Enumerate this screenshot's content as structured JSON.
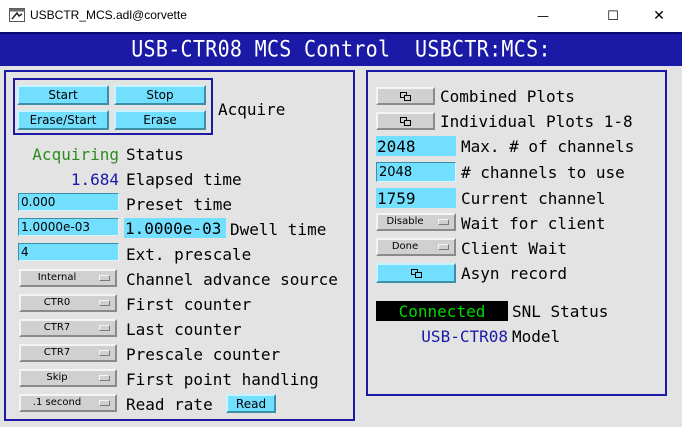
{
  "window": {
    "title": "USBCTR_MCS.adl@corvette",
    "minimize_glyph": "—",
    "maximize_glyph": "☐",
    "close_glyph": "✕"
  },
  "banner": {
    "title": "USB-CTR08 MCS Control  USBCTR:MCS:"
  },
  "acquire": {
    "start_label": "Start",
    "stop_label": "Stop",
    "erase_start_label": "Erase/Start",
    "erase_label": "Erase",
    "group_label": "Acquire"
  },
  "status": {
    "value": "Acquiring",
    "label": "Status",
    "value_color": "#2e8b20"
  },
  "elapsed": {
    "value": "1.684",
    "label": "Elapsed time",
    "value_color": "#1a1aa6"
  },
  "preset": {
    "value": "0.000",
    "label": "Preset time"
  },
  "dwell": {
    "input_value": "1.0000e-03",
    "readback": "1.0000e-03",
    "label": "Dwell time"
  },
  "prescale": {
    "value": "4",
    "label": "Ext. prescale"
  },
  "channel_advance": {
    "value": "Internal",
    "label": "Channel advance source"
  },
  "first_counter": {
    "value": "CTR0",
    "label": "First counter"
  },
  "last_counter": {
    "value": "CTR7",
    "label": "Last counter"
  },
  "prescale_counter": {
    "value": "CTR7",
    "label": "Prescale counter"
  },
  "first_point": {
    "value": "Skip",
    "label": "First point handling"
  },
  "read_rate": {
    "value": ".1 second",
    "label": "Read rate",
    "read_button": "Read"
  },
  "right": {
    "combined_plots": "Combined Plots",
    "individual_plots": "Individual Plots 1-8",
    "max_channels": {
      "value": "2048",
      "label": "Max. # of channels"
    },
    "channels_to_use": {
      "value": "2048",
      "label": "# channels to use"
    },
    "current_channel": {
      "value": "1759",
      "label": "Current channel"
    },
    "wait_for_client": {
      "value": "Disable",
      "label": "Wait for client"
    },
    "client_wait": {
      "value": "Done",
      "label": "Client Wait"
    },
    "asyn_record": {
      "label": "Asyn record"
    },
    "snl": {
      "value": "Connected",
      "label": "SNL Status"
    },
    "model": {
      "value": "USB-CTR08",
      "label": "Model",
      "value_color": "#1a1aa6"
    }
  },
  "colors": {
    "banner": "#1a1aa6",
    "control_bg": "#73dfff",
    "background": "#e3e3e3",
    "alarm_green": "#00d800"
  }
}
